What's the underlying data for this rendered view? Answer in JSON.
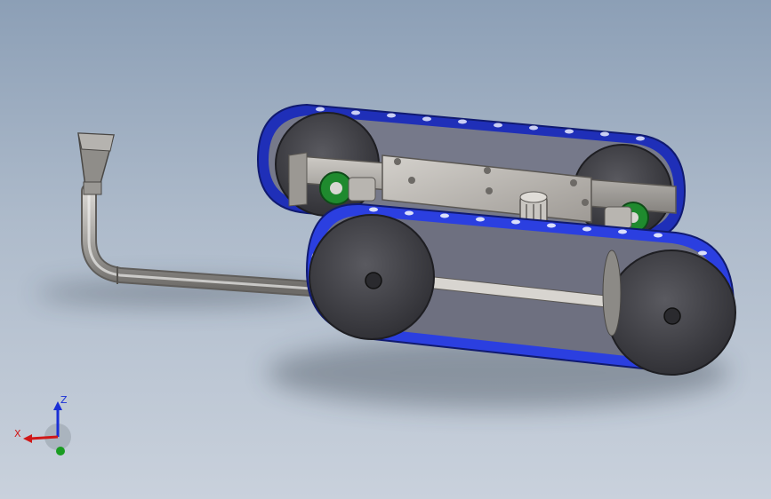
{
  "view": {
    "background_top": "#8c9fb6",
    "background_bottom": "#c9d1dc"
  },
  "model": {
    "track_color": "#2b3fe0",
    "wheel_color": "#3f3f44",
    "plate_color": "#bdb9b4",
    "pipe_color": "#a9a7a3",
    "motor_accent": "#1f8a2e"
  },
  "triad": {
    "x_label": "X",
    "z_label": "Z",
    "x_color": "#d01818",
    "z_color": "#1a2fd6",
    "y_color": "#1a9c22"
  }
}
